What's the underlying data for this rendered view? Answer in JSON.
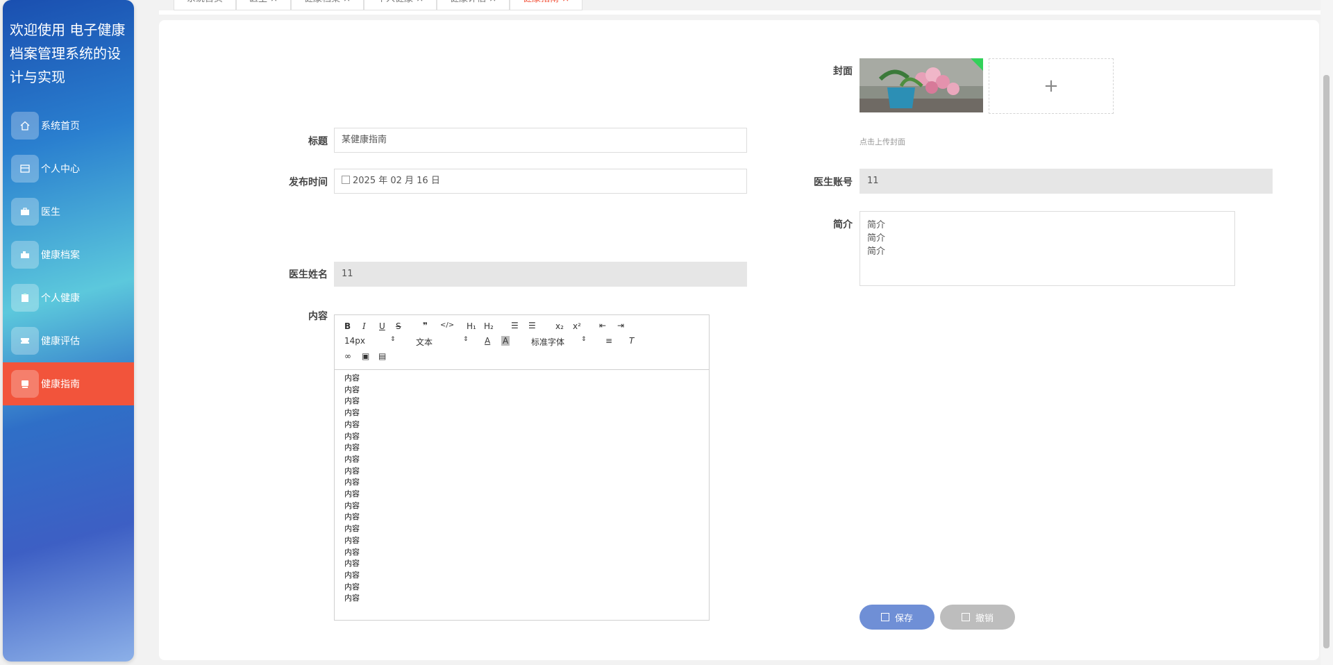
{
  "app": {
    "title": "欢迎使用 电子健康档案管理系统的设计与实现"
  },
  "sidebar": {
    "items": [
      {
        "label": "系统首页",
        "icon": "home-icon"
      },
      {
        "label": "个人中心",
        "icon": "card-icon"
      },
      {
        "label": "医生",
        "icon": "briefcase-icon"
      },
      {
        "label": "健康档案",
        "icon": "folder-icon"
      },
      {
        "label": "个人健康",
        "icon": "clipboard-icon"
      },
      {
        "label": "健康评估",
        "icon": "ticket-icon"
      },
      {
        "label": "健康指南",
        "icon": "book-icon",
        "active": true
      }
    ]
  },
  "tabs": [
    {
      "label": "系统首页"
    },
    {
      "label": "医生 ×"
    },
    {
      "label": "健康档案 ×"
    },
    {
      "label": "个人健康 ×"
    },
    {
      "label": "健康评估 ×"
    },
    {
      "label": "健康指南 ×",
      "active": true
    }
  ],
  "form": {
    "title_label": "标题",
    "title_value": "某健康指南",
    "publish_label": "发布时间",
    "publish_value": "2025 年 02 月 16 日",
    "doctor_name_label": "医生姓名",
    "doctor_name_value": "11",
    "content_label": "内容",
    "cover_label": "封面",
    "cover_hint": "点击上传封面",
    "doctor_account_label": "医生账号",
    "doctor_account_value": "11",
    "intro_label": "简介",
    "intro_lines": [
      "简介",
      "简介",
      "简介"
    ],
    "content_lines": [
      "内容",
      "内容",
      "内容",
      "内容",
      "内容",
      "内容",
      "内容",
      "内容",
      "内容",
      "内容",
      "内容",
      "内容",
      "内容",
      "内容",
      "内容",
      "内容",
      "内容",
      "内容",
      "内容",
      "内容"
    ]
  },
  "editor": {
    "font_size": "14px",
    "block_type": "文本",
    "font_family": "标准字体"
  },
  "buttons": {
    "save": "保存",
    "cancel": "撤销"
  },
  "colors": {
    "accent": "#f2543b",
    "primary": "#6f8fd6"
  }
}
